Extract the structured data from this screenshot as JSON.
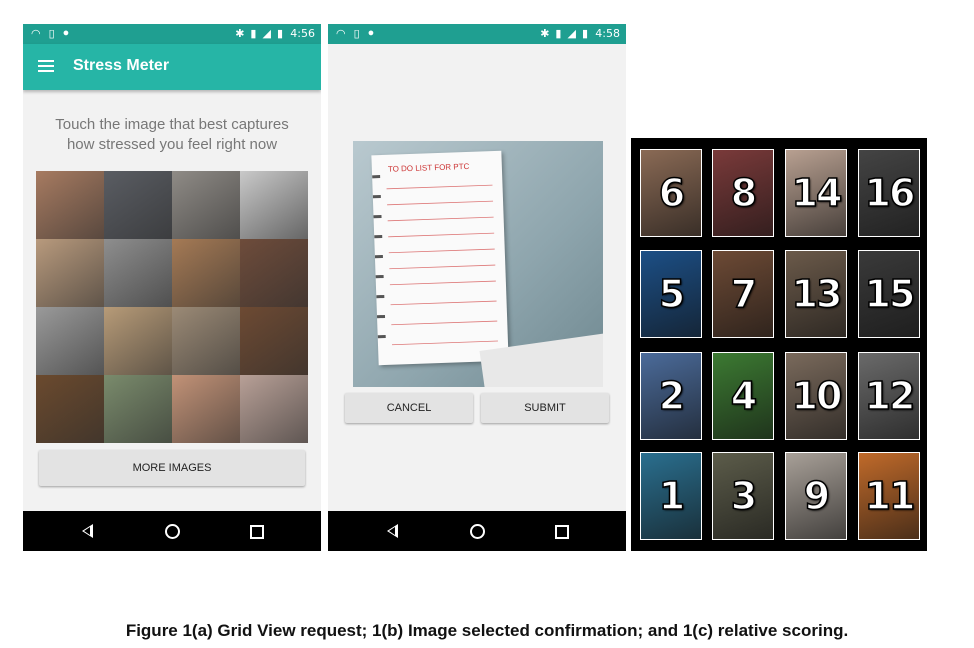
{
  "screen_a": {
    "time": "4:56",
    "app_title": "Stress Meter",
    "prompt_line1": "Touch the image that best captures",
    "prompt_line2": "how stressed you feel right now",
    "more_images_label": "MORE IMAGES",
    "grid_colors": [
      "#a77b61",
      "#5a5d63",
      "#8f8b86",
      "#c9c9c9",
      "#b89a7d",
      "#8e8e8e",
      "#a57a55",
      "#6e4c3b",
      "#9a9a9a",
      "#b79b78",
      "#9b8a76",
      "#6d4a33",
      "#6b4a2e",
      "#7a8b6c",
      "#c29277",
      "#b8a097"
    ]
  },
  "screen_b": {
    "time": "4:58",
    "notepad_title": "TO DO LIST FOR PTC",
    "cancel_label": "CANCEL",
    "submit_label": "SUBMIT"
  },
  "scoring": {
    "rows": [
      [
        "6",
        "8",
        "14",
        "16"
      ],
      [
        "5",
        "7",
        "13",
        "15"
      ],
      [
        "2",
        "4",
        "10",
        "12"
      ],
      [
        "1",
        "3",
        "9",
        "11"
      ]
    ],
    "tile_colors": [
      [
        "#8a6a55",
        "#7a3a3a",
        "#b8a091",
        "#444444"
      ],
      [
        "#1c4f86",
        "#6d4a35",
        "#6b5a4a",
        "#3a3a3a"
      ],
      [
        "#4b6b9a",
        "#3c7a32",
        "#7a6a5c",
        "#6a6a6a"
      ],
      [
        "#2a6f8f",
        "#5c5c4a",
        "#a8a098",
        "#c06a2a"
      ]
    ]
  },
  "caption": "Figure 1(a) Grid View request; 1(b) Image selected confirmation; and 1(c) relative scoring."
}
